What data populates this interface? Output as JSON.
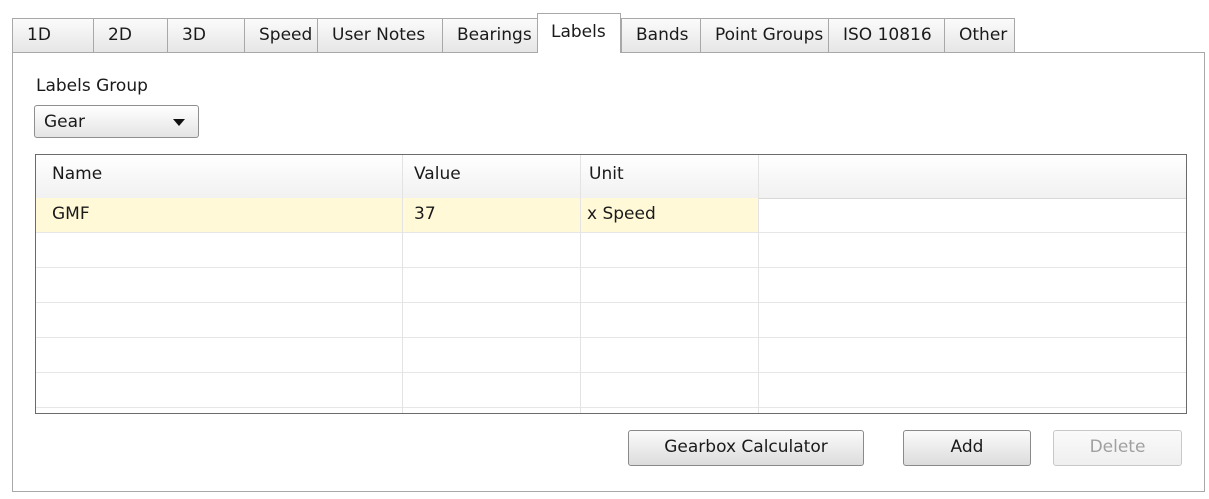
{
  "tabs": [
    {
      "label": "1D",
      "active": false
    },
    {
      "label": "2D",
      "active": false
    },
    {
      "label": "3D",
      "active": false
    },
    {
      "label": "Speed",
      "active": false
    },
    {
      "label": "User Notes",
      "active": false
    },
    {
      "label": "Bearings",
      "active": false
    },
    {
      "label": "Labels",
      "active": true
    },
    {
      "label": "Bands",
      "active": false
    },
    {
      "label": "Point Groups",
      "active": false
    },
    {
      "label": "ISO 10816",
      "active": false
    },
    {
      "label": "Other",
      "active": false
    }
  ],
  "labels_group": {
    "label": "Labels Group",
    "selected": "Gear"
  },
  "table": {
    "columns": [
      "Name",
      "Value",
      "Unit",
      ""
    ],
    "rows": [
      {
        "name": "GMF",
        "value": "37",
        "unit": "x Speed",
        "selected": true
      },
      {
        "name": "",
        "value": "",
        "unit": ""
      },
      {
        "name": "",
        "value": "",
        "unit": ""
      },
      {
        "name": "",
        "value": "",
        "unit": ""
      },
      {
        "name": "",
        "value": "",
        "unit": ""
      },
      {
        "name": "",
        "value": "",
        "unit": ""
      }
    ]
  },
  "buttons": {
    "gearbox_calculator": "Gearbox Calculator",
    "add": "Add",
    "delete": "Delete",
    "delete_enabled": false
  }
}
